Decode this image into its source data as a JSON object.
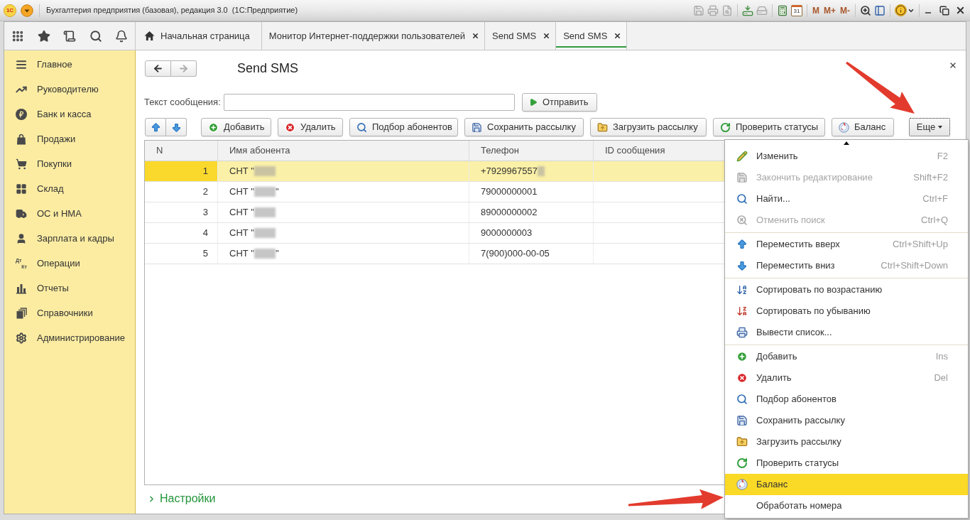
{
  "window": {
    "logo": "1С",
    "title": "Бухгалтерия предприятия (базовая), редакция 3.0  (1С:Предприятие)"
  },
  "title_toolbar": {
    "calendar_day": "31",
    "memory_buttons": [
      "M",
      "M+",
      "M-"
    ]
  },
  "tabs": [
    {
      "kind": "home",
      "label": "Начальная страница",
      "closable": false,
      "selected": false
    },
    {
      "kind": "form",
      "label": "Монитор Интернет-поддержки пользователей",
      "closable": true,
      "selected": false
    },
    {
      "kind": "form",
      "label": "Send SMS",
      "closable": true,
      "selected": false
    },
    {
      "kind": "form",
      "label": "Send SMS",
      "closable": true,
      "selected": true
    }
  ],
  "sidebar": {
    "items": [
      {
        "label": "Главное"
      },
      {
        "label": "Руководителю"
      },
      {
        "label": "Банк и касса"
      },
      {
        "label": "Продажи"
      },
      {
        "label": "Покупки"
      },
      {
        "label": "Склад"
      },
      {
        "label": "ОС и НМА"
      },
      {
        "label": "Зарплата и кадры"
      },
      {
        "label": "Операции",
        "icon_text": [
          "Дт",
          "Кт"
        ]
      },
      {
        "label": "Отчеты"
      },
      {
        "label": "Справочники"
      },
      {
        "label": "Администрирование"
      }
    ]
  },
  "form": {
    "title": "Send SMS",
    "message_label": "Текст сообщения:",
    "send_button": "Отправить"
  },
  "toolbar": {
    "buttons": [
      {
        "label": "Добавить"
      },
      {
        "label": "Удалить"
      },
      {
        "label": "Подбор абонентов"
      },
      {
        "label": "Сохранить рассылку"
      },
      {
        "label": "Загрузить рассылку"
      },
      {
        "label": "Проверить статусы"
      },
      {
        "label": "Баланс"
      }
    ],
    "more_button": "Еще"
  },
  "table": {
    "columns": [
      "N",
      "Имя абонента",
      "Телефон",
      "ID сообщения"
    ],
    "rows": [
      {
        "n": "1",
        "name": "СНТ \"",
        "name_blurred": true,
        "phone": "+7929967557",
        "phone_blurred": true,
        "selected": true
      },
      {
        "n": "2",
        "name": "СНТ \"",
        "name_blurred": true,
        "name_end": "\"",
        "phone": "79000000001",
        "phone_blurred": false,
        "selected": false
      },
      {
        "n": "3",
        "name": "СНТ \"",
        "name_blurred": true,
        "phone": "89000000002",
        "phone_blurred": false,
        "selected": false
      },
      {
        "n": "4",
        "name": "СНТ \"",
        "name_blurred": true,
        "phone": "9000000003",
        "phone_blurred": false,
        "selected": false
      },
      {
        "n": "5",
        "name": "СНТ \"",
        "name_blurred": true,
        "name_end": "\"",
        "phone": "7(900)000-00-05",
        "phone_blurred": false,
        "selected": false
      }
    ]
  },
  "settings_link": "Настройки",
  "menu": {
    "sections": [
      {
        "items": [
          {
            "label": "Изменить",
            "shortcut": "F2",
            "disabled": false,
            "selected": false
          },
          {
            "label": "Закончить редактирование",
            "shortcut": "Shift+F2",
            "disabled": true,
            "selected": false
          },
          {
            "label": "Найти...",
            "shortcut": "Ctrl+F",
            "disabled": false,
            "selected": false
          },
          {
            "label": "Отменить поиск",
            "shortcut": "Ctrl+Q",
            "disabled": true,
            "selected": false
          }
        ]
      },
      {
        "items": [
          {
            "label": "Переместить вверх",
            "shortcut": "Ctrl+Shift+Up",
            "disabled": false,
            "selected": false
          },
          {
            "label": "Переместить вниз",
            "shortcut": "Ctrl+Shift+Down",
            "disabled": false,
            "selected": false
          }
        ]
      },
      {
        "items": [
          {
            "label": "Сортировать по возрастанию",
            "disabled": false,
            "selected": false
          },
          {
            "label": "Сортировать по убыванию",
            "disabled": false,
            "selected": false
          },
          {
            "label": "Вывести список...",
            "disabled": false,
            "selected": false
          }
        ]
      },
      {
        "items": [
          {
            "label": "Добавить",
            "shortcut": "Ins",
            "disabled": false,
            "selected": false
          },
          {
            "label": "Удалить",
            "shortcut": "Del",
            "disabled": false,
            "selected": false
          },
          {
            "label": "Подбор абонентов",
            "disabled": false,
            "selected": false
          },
          {
            "label": "Сохранить рассылку",
            "disabled": false,
            "selected": false
          },
          {
            "label": "Загрузить рассылку",
            "disabled": false,
            "selected": false
          },
          {
            "label": "Проверить статусы",
            "disabled": false,
            "selected": false
          },
          {
            "label": "Баланс",
            "disabled": false,
            "selected": true
          },
          {
            "label": "Обработать номера",
            "disabled": false,
            "selected": false
          }
        ]
      }
    ]
  }
}
